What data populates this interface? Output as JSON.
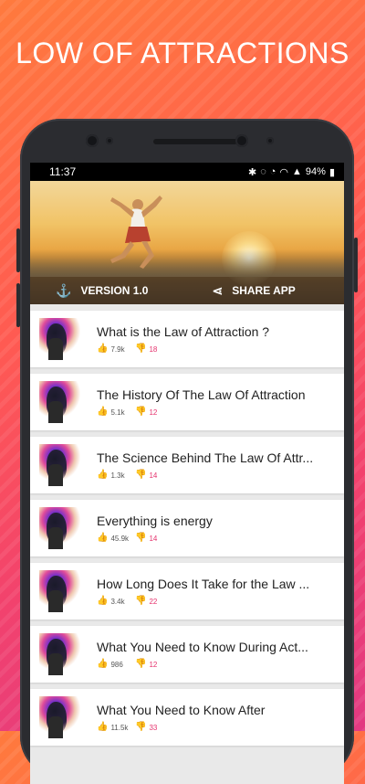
{
  "headline": "LOW OF ATTRACTIONS",
  "status": {
    "time": "11:37",
    "battery": "94%"
  },
  "hero": {
    "version_label": "VERSION 1.0",
    "share_label": "SHARE APP"
  },
  "articles": [
    {
      "title": "What is the Law of Attraction ?",
      "likes": "7.9k",
      "dislikes": "18"
    },
    {
      "title": "The History Of The Law Of Attraction",
      "likes": "5.1k",
      "dislikes": "12"
    },
    {
      "title": "The Science Behind The Law Of Attr...",
      "likes": "1.3k",
      "dislikes": "14"
    },
    {
      "title": "Everything is energy",
      "likes": "45.9k",
      "dislikes": "14"
    },
    {
      "title": "How Long Does It Take for the Law ...",
      "likes": "3.4k",
      "dislikes": "22"
    },
    {
      "title": "What You Need to Know During Act...",
      "likes": "986",
      "dislikes": "12"
    },
    {
      "title": "What You Need to Know After",
      "likes": "11.5k",
      "dislikes": "33"
    }
  ],
  "icons": {
    "anchor": "anchor-icon",
    "share": "share-icon",
    "like": "thumbs-up-icon",
    "dislike": "thumbs-down-icon"
  },
  "colors": {
    "like": "#3d5bd6",
    "dislike": "#e6336e"
  }
}
